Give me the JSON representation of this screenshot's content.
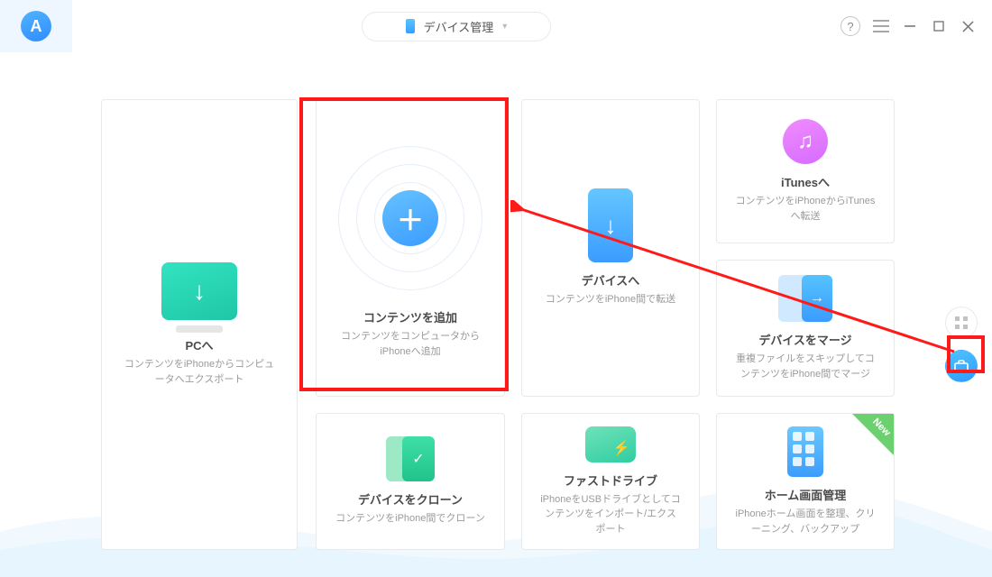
{
  "header": {
    "device_label": "デバイス管理"
  },
  "side": {
    "grid_label": "grid-view",
    "toolbox_label": "toolbox"
  },
  "cards": {
    "pc": {
      "title": "PCへ",
      "desc": "コンテンツをiPhoneからコンピュータへエクスポート"
    },
    "add": {
      "title": "コンテンツを追加",
      "desc": "コンテンツをコンピュータからiPhoneへ追加"
    },
    "device": {
      "title": "デバイスへ",
      "desc": "コンテンツをiPhone間で転送"
    },
    "itunes": {
      "title": "iTunesへ",
      "desc": "コンテンツをiPhoneからiTunesへ転送"
    },
    "merge": {
      "title": "デバイスをマージ",
      "desc": "重複ファイルをスキップしてコンテンツをiPhone間でマージ"
    },
    "clone": {
      "title": "デバイスをクローン",
      "desc": "コンテンツをiPhone間でクローン"
    },
    "drive": {
      "title": "ファストドライブ",
      "desc": "iPhoneをUSBドライブとしてコンテンツをインポート/エクスポート"
    },
    "home": {
      "title": "ホーム画面管理",
      "desc": "iPhoneホーム画面を整理、クリーニング、バックアップ",
      "badge": "New"
    }
  }
}
